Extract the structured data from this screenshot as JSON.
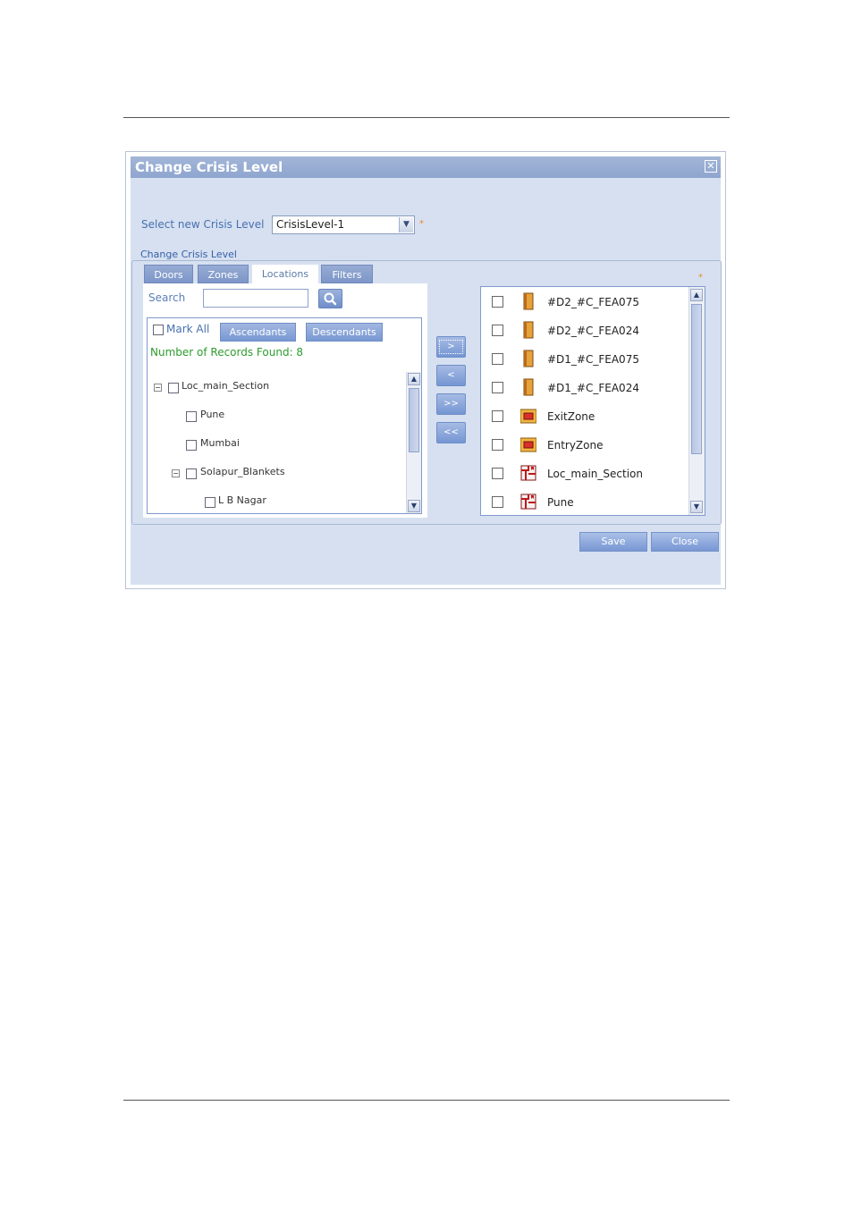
{
  "dialog": {
    "title": "Change Crisis Level",
    "close_icon": "close-x-icon"
  },
  "crisis_select": {
    "label": "Select new Crisis Level",
    "value": "CrisisLevel-1",
    "required_marker": "*"
  },
  "section": {
    "legend": "Change Crisis Level",
    "required_marker": "*"
  },
  "tabs": [
    {
      "label": "Doors",
      "active": false
    },
    {
      "label": "Zones",
      "active": false
    },
    {
      "label": "Locations",
      "active": true
    },
    {
      "label": "Filters",
      "active": false
    }
  ],
  "search": {
    "label": "Search",
    "value": "",
    "icon": "magnifier-icon"
  },
  "list_controls": {
    "mark_all_label": "Mark All",
    "ascendants_label": "Ascendants",
    "descendants_label": "Descendants",
    "records_found": "Number of Records Found: 8"
  },
  "tree": [
    {
      "label": "Loc_main_Section",
      "level": 0,
      "expanded": true
    },
    {
      "label": "Pune",
      "level": 1
    },
    {
      "label": "Mumbai",
      "level": 1
    },
    {
      "label": "Solapur_Blankets",
      "level": 1,
      "expanded": true
    },
    {
      "label": "L B Nagar",
      "level": 2
    }
  ],
  "move_buttons": {
    "add": ">",
    "remove": "<",
    "add_all": ">>",
    "remove_all": "<<"
  },
  "selected_items": [
    {
      "label": "#D2_#C_FEA075",
      "icon": "door-icon"
    },
    {
      "label": "#D2_#C_FEA024",
      "icon": "door-icon"
    },
    {
      "label": "#D1_#C_FEA075",
      "icon": "door-icon"
    },
    {
      "label": "#D1_#C_FEA024",
      "icon": "door-icon"
    },
    {
      "label": "ExitZone",
      "icon": "zone-icon"
    },
    {
      "label": "EntryZone",
      "icon": "zone-icon"
    },
    {
      "label": "Loc_main_Section",
      "icon": "location-map-icon"
    },
    {
      "label": "Pune",
      "icon": "location-map-icon"
    }
  ],
  "footer": {
    "save_label": "Save",
    "close_label": "Close"
  },
  "colors": {
    "title_bar": "#8ea5cf",
    "panel_bg": "#d6e0f0",
    "accent_blue": "#4870b0",
    "records_green": "#2d9c2d",
    "required_orange": "#f08a28"
  }
}
